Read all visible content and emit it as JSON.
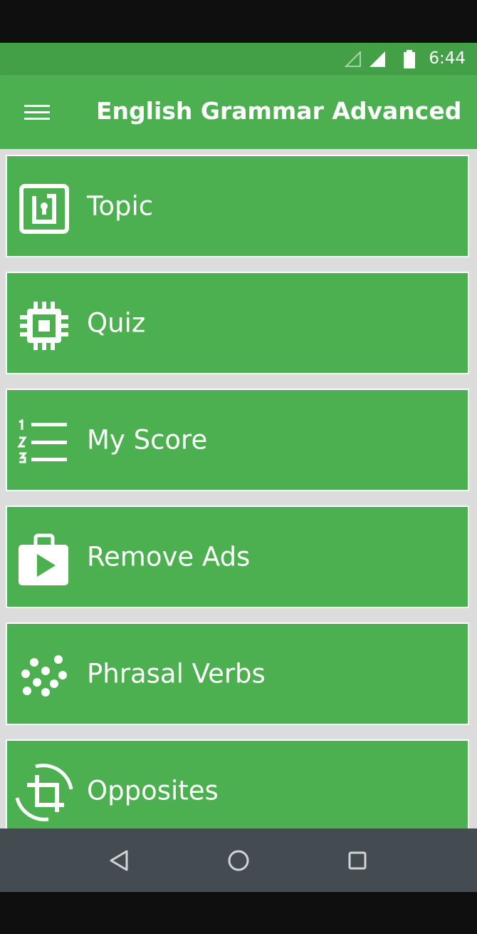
{
  "status_bar": {
    "time": "6:44",
    "icons": [
      "signal-outline-icon",
      "signal-full-icon",
      "battery-icon"
    ],
    "color": "#43a047"
  },
  "app_bar": {
    "title": "English Grammar Advanced",
    "menu_icon": "hamburger-menu-icon",
    "color": "#4caf50"
  },
  "menu": {
    "items": [
      {
        "label": "Topic",
        "icon": "nfc-box-icon"
      },
      {
        "label": "Quiz",
        "icon": "chip-icon"
      },
      {
        "label": "My Score",
        "icon": "numbered-list-icon"
      },
      {
        "label": "Remove Ads",
        "icon": "play-store-icon"
      },
      {
        "label": "Phrasal Verbs",
        "icon": "dots-pattern-icon"
      },
      {
        "label": "Opposites",
        "icon": "crop-rotate-icon"
      }
    ]
  },
  "nav_bar": {
    "buttons": [
      "back-icon",
      "home-icon",
      "recents-icon"
    ],
    "color": "#454c51"
  }
}
